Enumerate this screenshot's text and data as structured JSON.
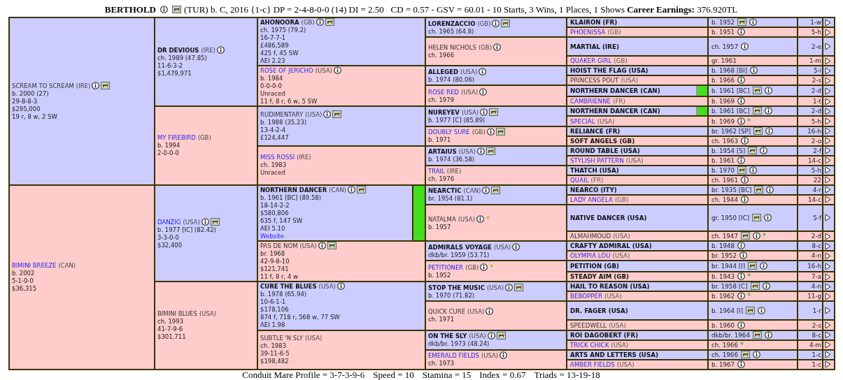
{
  "header": {
    "title": "BERTHOLD",
    "icons": [
      {
        "kind": "info"
      },
      {
        "kind": "photo"
      }
    ],
    "summary": "(TUR) b. C, 2016 {1-c} DP = 2-4-8-0-0 (14) DI = 2.50   CD = 0.57 - GSV = 60.01 - 10 Starts, 3 Wins, 1 Places, 1 Shows **Career Earnings:** 376.920TL"
  },
  "pedigree": [
    {
      "name": "SCREAM TO SCREAM",
      "country": "(IRE)",
      "bold": false,
      "link": false,
      "female": false,
      "icons": [
        {
          "kind": "info"
        },
        {
          "kind": "photo"
        }
      ],
      "lines": [
        "b. 2000 (27)",
        "29-8-8-3",
        "$295,000",
        "19 r, 8 w, 2 SW"
      ],
      "parents": [
        {
          "name": "DR DEVIOUS",
          "country": "(IRE)",
          "bold": true,
          "link": false,
          "female": false,
          "icons": [
            {
              "kind": "info"
            }
          ],
          "lines": [
            "ch. 1989 (47.85)",
            "11-6-3-2",
            "$1,479,971"
          ],
          "parents": [
            {
              "name": "AHONOORA",
              "country": "(GB)",
              "bold": true,
              "link": false,
              "female": false,
              "icons": [
                {
                  "kind": "info"
                },
                {
                  "kind": "photo"
                }
              ],
              "lines": [
                "ch. 1975 (79.2)",
                "16-7-7-1",
                "£486,589",
                "425 f, 45 SW",
                "AEI 2.23"
              ],
              "parents": [
                {
                  "name": "LORENZACCIO",
                  "country": "(GB)",
                  "bold": true,
                  "link": false,
                  "female": false,
                  "icons": [
                    {
                      "kind": "info"
                    },
                    {
                      "kind": "photo"
                    }
                  ],
                  "lines": [
                    "ch. 1965 (64.8)"
                  ],
                  "parents": [
                    {
                      "name": "KLAIRON (FR)",
                      "bold": true,
                      "link": false,
                      "female": false,
                      "info": "b. 1952",
                      "icons": [
                        {
                          "kind": "photo"
                        },
                        {
                          "kind": "info"
                        }
                      ],
                      "code": "1-w"
                    },
                    {
                      "name": "PHOENISSA",
                      "country": "(GB)",
                      "bold": false,
                      "link": true,
                      "female": true,
                      "info": "b. 1951",
                      "icons": [
                        {
                          "kind": "info"
                        }
                      ],
                      "code": "5-h"
                    }
                  ]
                },
                {
                  "name": "HELEN NICHOLS",
                  "country": "(GB)",
                  "bold": false,
                  "link": false,
                  "female": true,
                  "icons": [
                    {
                      "kind": "info"
                    }
                  ],
                  "lines": [
                    "ch. 1966"
                  ],
                  "parents": [
                    {
                      "name": "MARTIAL (IRE)",
                      "bold": true,
                      "link": false,
                      "female": false,
                      "info": "ch. 1957",
                      "icons": [
                        {
                          "kind": "info"
                        }
                      ],
                      "code": "2-e"
                    },
                    {
                      "name": "QUAKER GIRL",
                      "country": "(GB)",
                      "bold": false,
                      "link": true,
                      "female": true,
                      "info": "gr. 1961",
                      "code": "1-m"
                    }
                  ]
                }
              ]
            },
            {
              "name": "ROSE OF JERICHO",
              "country": "(USA)",
              "bold": false,
              "link": true,
              "female": true,
              "icons": [
                {
                  "kind": "info"
                }
              ],
              "lines": [
                "b. 1984",
                "0-0-0-0",
                "Unraced",
                "11 f, 8 r, 6 w, 5 SW"
              ],
              "parents": [
                {
                  "name": "ALLEGED",
                  "country": "(USA)",
                  "bold": true,
                  "link": false,
                  "female": false,
                  "icons": [
                    {
                      "kind": "info"
                    }
                  ],
                  "lines": [
                    "b. 1974 (80.06)"
                  ],
                  "parents": [
                    {
                      "name": "HOIST THE FLAG (USA)",
                      "bold": true,
                      "link": false,
                      "female": false,
                      "info": "b. 1968 [BI]",
                      "icons": [
                        {
                          "kind": "info"
                        }
                      ],
                      "code": "5-i"
                    },
                    {
                      "name": "PRINCESS POUT",
                      "country": "(USA)",
                      "bold": false,
                      "link": false,
                      "female": true,
                      "info": "b. 1966",
                      "icons": [
                        {
                          "kind": "info"
                        }
                      ],
                      "code": "2-s"
                    }
                  ]
                },
                {
                  "name": "ROSE RED",
                  "country": "(USA)",
                  "bold": false,
                  "link": true,
                  "female": true,
                  "icons": [
                    {
                      "kind": "info"
                    }
                  ],
                  "lines": [
                    "ch. 1979"
                  ],
                  "parents": [
                    {
                      "name": "NORTHERN DANCER (CAN)",
                      "bold": true,
                      "link": false,
                      "female": false,
                      "highlighted": true,
                      "info": "b. 1961 [BC]",
                      "icons": [
                        {
                          "kind": "photo"
                        },
                        {
                          "kind": "info"
                        }
                      ],
                      "code": "2-d"
                    },
                    {
                      "name": "CAMBRIENNE",
                      "country": "(FR)",
                      "bold": false,
                      "link": true,
                      "female": true,
                      "info": "b. 1969",
                      "icons": [
                        {
                          "kind": "info"
                        }
                      ],
                      "code": "1-t"
                    }
                  ]
                }
              ]
            }
          ]
        },
        {
          "name": "MY FIREBIRD",
          "country": "(GB)",
          "bold": false,
          "link": true,
          "female": true,
          "lines": [
            "b. 1994",
            "2-0-0-0"
          ],
          "parents": [
            {
              "name": "RUDIMENTARY",
              "country": "(USA)",
              "bold": false,
              "link": false,
              "female": false,
              "icons": [
                {
                  "kind": "info"
                },
                {
                  "kind": "photo"
                }
              ],
              "lines": [
                "b. 1988 (35.23)",
                "13-4-2-4",
                "£124,447"
              ],
              "parents": [
                {
                  "name": "NUREYEV",
                  "country": "(USA)",
                  "bold": true,
                  "link": false,
                  "female": false,
                  "icons": [
                    {
                      "kind": "info"
                    },
                    {
                      "kind": "photo"
                    }
                  ],
                  "lines": [
                    "b. 1977 [C] (85.89)"
                  ],
                  "parents": [
                    {
                      "name": "NORTHERN DANCER (CAN)",
                      "bold": true,
                      "link": false,
                      "female": false,
                      "highlighted": true,
                      "info": "b. 1961 [BC]",
                      "icons": [
                        {
                          "kind": "photo"
                        },
                        {
                          "kind": "info"
                        }
                      ],
                      "code": "2-d"
                    },
                    {
                      "name": "SPECIAL",
                      "country": "(USA)",
                      "bold": false,
                      "link": true,
                      "female": true,
                      "info": "b. 1969",
                      "icons": [
                        {
                          "kind": "info"
                        }
                      ],
                      "note": "*",
                      "code": "5-h"
                    }
                  ]
                },
                {
                  "name": "DOUBLY SURE",
                  "country": "(GB)",
                  "bold": false,
                  "link": true,
                  "female": true,
                  "icons": [
                    {
                      "kind": "info"
                    },
                    {
                      "kind": "photo"
                    }
                  ],
                  "lines": [
                    "b. 1971"
                  ],
                  "parents": [
                    {
                      "name": "RELIANCE (FR)",
                      "bold": true,
                      "link": false,
                      "female": false,
                      "info": "br. 1962 [SP]",
                      "icons": [
                        {
                          "kind": "photo"
                        },
                        {
                          "kind": "info"
                        }
                      ],
                      "code": "16-h"
                    },
                    {
                      "name": "SOFT ANGELS (GB)",
                      "bold": true,
                      "link": false,
                      "female": true,
                      "info": "ch. 1963",
                      "icons": [
                        {
                          "kind": "info"
                        }
                      ],
                      "code": "2-o"
                    }
                  ]
                }
              ]
            },
            {
              "name": "MISS ROSSI",
              "country": "(IRE)",
              "bold": false,
              "link": true,
              "female": true,
              "lines": [
                "ch. 1983",
                "Unraced"
              ],
              "parents": [
                {
                  "name": "ARTAIUS",
                  "country": "(USA)",
                  "bold": true,
                  "link": false,
                  "female": false,
                  "icons": [
                    {
                      "kind": "info"
                    },
                    {
                      "kind": "photo"
                    }
                  ],
                  "lines": [
                    "b. 1974 (36.58)"
                  ],
                  "parents": [
                    {
                      "name": "ROUND TABLE (USA)",
                      "bold": true,
                      "link": false,
                      "female": false,
                      "info": "b. 1954 [S]",
                      "icons": [
                        {
                          "kind": "photo"
                        },
                        {
                          "kind": "info"
                        }
                      ],
                      "code": "2-f"
                    },
                    {
                      "name": "STYLISH PATTERN",
                      "country": "(USA)",
                      "bold": false,
                      "link": true,
                      "female": true,
                      "info": "b. 1961",
                      "icons": [
                        {
                          "kind": "info"
                        }
                      ],
                      "code": "14-c"
                    }
                  ]
                },
                {
                  "name": "TRAIL",
                  "country": "(IRE)",
                  "bold": false,
                  "link": true,
                  "female": true,
                  "lines": [
                    "ch. 1976"
                  ],
                  "parents": [
                    {
                      "name": "THATCH (USA)",
                      "bold": true,
                      "link": false,
                      "female": false,
                      "info": "b. 1970",
                      "icons": [
                        {
                          "kind": "photo"
                        },
                        {
                          "kind": "info"
                        }
                      ],
                      "code": "5-h"
                    },
                    {
                      "name": "QUAIL",
                      "country": "(FR)",
                      "bold": false,
                      "link": true,
                      "female": true,
                      "info": "ch. 1961",
                      "icons": [
                        {
                          "kind": "info"
                        }
                      ],
                      "code": "22"
                    }
                  ]
                }
              ]
            }
          ]
        }
      ]
    },
    {
      "name": "BIMINI BREEZE",
      "country": "(CAN)",
      "bold": false,
      "link": true,
      "female": true,
      "lines": [
        "b. 2002",
        "5-1-0-0",
        "$36,315"
      ],
      "parents": [
        {
          "name": "DANZIG",
          "country": "(USA)",
          "bold": false,
          "link": true,
          "female": false,
          "icons": [
            {
              "kind": "info"
            },
            {
              "kind": "photo"
            }
          ],
          "lines": [
            "b. 1977 [IC] (82.42)",
            "3-3-0-0",
            "$32,400"
          ],
          "parents": [
            {
              "name": "NORTHERN DANCER",
              "country": "(CAN)",
              "bold": true,
              "link": false,
              "female": false,
              "highlighted": true,
              "icons": [
                {
                  "kind": "info"
                },
                {
                  "kind": "photo"
                }
              ],
              "lines": [
                "b. 1961 [BC] (89.58)",
                "18-14-2-2",
                "$580,806",
                "635 f, 147 SW",
                "AEI 5.10"
              ],
              "website": "Website",
              "parents": [
                {
                  "name": "NEARCTIC",
                  "country": "(CAN)",
                  "bold": true,
                  "link": false,
                  "female": false,
                  "icons": [
                    {
                      "kind": "info"
                    },
                    {
                      "kind": "photo"
                    }
                  ],
                  "lines": [
                    "br. 1954 (81.1)"
                  ],
                  "parents": [
                    {
                      "name": "NEARCO (ITY)",
                      "bold": true,
                      "link": false,
                      "female": false,
                      "info": "br. 1935 [BC]",
                      "icons": [
                        {
                          "kind": "photo"
                        },
                        {
                          "kind": "info"
                        }
                      ],
                      "code": "4-r"
                    },
                    {
                      "name": "LADY ANGELA",
                      "country": "(GB)",
                      "bold": false,
                      "link": true,
                      "female": true,
                      "info": "ch. 1944",
                      "icons": [
                        {
                          "kind": "info"
                        }
                      ],
                      "code": "14-c"
                    }
                  ]
                },
                {
                  "name": "NATALMA",
                  "country": "(USA)",
                  "bold": false,
                  "link": false,
                  "female": true,
                  "icons": [
                    {
                      "kind": "info"
                    }
                  ],
                  "note": "*",
                  "lines": [
                    "b. 1957"
                  ],
                  "parents": [
                    {
                      "name": "NATIVE DANCER (USA)",
                      "bold": true,
                      "link": false,
                      "female": false,
                      "info": "gr. 1950 [IC]",
                      "icons": [
                        {
                          "kind": "photo"
                        },
                        {
                          "kind": "info"
                        }
                      ],
                      "code": "5-f"
                    },
                    {
                      "name": "ALMAHMOUD",
                      "country": "(USA)",
                      "bold": false,
                      "link": false,
                      "female": true,
                      "info": "ch. 1947",
                      "icons": [
                        {
                          "kind": "photo"
                        },
                        {
                          "kind": "info"
                        }
                      ],
                      "note": "*",
                      "code": "2-d"
                    }
                  ]
                }
              ]
            },
            {
              "name": "PAS DE NOM",
              "country": "(USA)",
              "bold": false,
              "link": false,
              "female": true,
              "icons": [
                {
                  "kind": "info"
                },
                {
                  "kind": "photo"
                }
              ],
              "lines": [
                "br. 1968",
                "42-9-8-10",
                "$121,741",
                "11 f, 8 r, 4 w"
              ],
              "parents": [
                {
                  "name": "ADMIRALS VOYAGE",
                  "country": "(USA)",
                  "bold": true,
                  "link": false,
                  "female": false,
                  "icons": [
                    {
                      "kind": "info"
                    }
                  ],
                  "lines": [
                    "dkb/br. 1959 (53.71)"
                  ],
                  "parents": [
                    {
                      "name": "CRAFTY ADMIRAL (USA)",
                      "bold": true,
                      "link": false,
                      "female": false,
                      "info": "b. 1948",
                      "icons": [
                        {
                          "kind": "info"
                        }
                      ],
                      "code": "8-c"
                    },
                    {
                      "name": "OLYMPIA LOU",
                      "country": "(USA)",
                      "bold": false,
                      "link": true,
                      "female": true,
                      "info": "br. 1952",
                      "icons": [
                        {
                          "kind": "info"
                        }
                      ],
                      "code": "4-n"
                    }
                  ]
                },
                {
                  "name": "PETITIONER",
                  "country": "(GB)",
                  "bold": false,
                  "link": true,
                  "female": true,
                  "icons": [
                    {
                      "kind": "info"
                    }
                  ],
                  "note": "*",
                  "lines": [
                    "b. 1952"
                  ],
                  "parents": [
                    {
                      "name": "PETITION (GB)",
                      "bold": true,
                      "link": false,
                      "female": false,
                      "info": "br. 1944 [I]",
                      "icons": [
                        {
                          "kind": "photo"
                        },
                        {
                          "kind": "info"
                        }
                      ],
                      "code": "16-h"
                    },
                    {
                      "name": "STEADY AIM (GB)",
                      "bold": true,
                      "link": false,
                      "female": true,
                      "info": "b. 1943",
                      "icons": [
                        {
                          "kind": "info"
                        }
                      ],
                      "note": "*",
                      "code": "7-a"
                    }
                  ]
                }
              ]
            }
          ]
        },
        {
          "name": "BIMINI BLUES",
          "country": "(USA)",
          "bold": false,
          "link": false,
          "female": true,
          "lines": [
            "ch. 1993",
            "41-7-9-6",
            "$301,711"
          ],
          "parents": [
            {
              "name": "CURE THE BLUES",
              "country": "(USA)",
              "bold": true,
              "link": false,
              "female": false,
              "icons": [
                {
                  "kind": "info"
                }
              ],
              "lines": [
                "b. 1978 (65.94)",
                "10-6-1-1",
                "$178,106",
                "874 f, 718 r, 568 w, 77 SW",
                "AEI 1.98"
              ],
              "parents": [
                {
                  "name": "STOP THE MUSIC",
                  "country": "(USA)",
                  "bold": true,
                  "link": false,
                  "female": false,
                  "icons": [
                    {
                      "kind": "info"
                    },
                    {
                      "kind": "photo"
                    }
                  ],
                  "lines": [
                    "b. 1970 (71.82)"
                  ],
                  "parents": [
                    {
                      "name": "HAIL TO REASON (USA)",
                      "bold": true,
                      "link": false,
                      "female": false,
                      "info": "br. 1958 [C]",
                      "icons": [
                        {
                          "kind": "photo"
                        },
                        {
                          "kind": "info"
                        }
                      ],
                      "code": "4-n"
                    },
                    {
                      "name": "BEBOPPER",
                      "country": "(USA)",
                      "bold": false,
                      "link": true,
                      "female": true,
                      "info": "b. 1962",
                      "icons": [
                        {
                          "kind": "info"
                        }
                      ],
                      "note": "*",
                      "code": "11-g"
                    }
                  ]
                },
                {
                  "name": "QUICK CURE",
                  "country": "(USA)",
                  "bold": false,
                  "link": false,
                  "female": true,
                  "icons": [
                    {
                      "kind": "info"
                    }
                  ],
                  "lines": [
                    "ch. 1971"
                  ],
                  "parents": [
                    {
                      "name": "DR. FAGER (USA)",
                      "bold": true,
                      "link": false,
                      "female": false,
                      "info": "b. 1964 [I]",
                      "icons": [
                        {
                          "kind": "photo"
                        },
                        {
                          "kind": "info"
                        }
                      ],
                      "code": "1-r"
                    },
                    {
                      "name": "SPEEDWELL",
                      "country": "(USA)",
                      "bold": false,
                      "link": false,
                      "female": true,
                      "info": "b. 1960",
                      "icons": [
                        {
                          "kind": "info"
                        }
                      ],
                      "code": "2-s"
                    }
                  ]
                }
              ]
            },
            {
              "name": "SUBTLE 'N SLY",
              "country": "(USA)",
              "bold": false,
              "link": false,
              "female": true,
              "lines": [
                "ch. 1983",
                "39-11-6-5",
                "$198,482"
              ],
              "parents": [
                {
                  "name": "ON THE SLY",
                  "country": "(USA)",
                  "bold": true,
                  "link": false,
                  "female": false,
                  "icons": [
                    {
                      "kind": "info"
                    },
                    {
                      "kind": "photo"
                    }
                  ],
                  "lines": [
                    "dkb/br. 1973 (48.24)"
                  ],
                  "parents": [
                    {
                      "name": "ROI DAGOBERT (FR)",
                      "bold": true,
                      "link": false,
                      "female": false,
                      "info": "dkb/br. 1964",
                      "icons": [
                        {
                          "kind": "photo"
                        },
                        {
                          "kind": "info"
                        }
                      ],
                      "code": "8-c"
                    },
                    {
                      "name": "TRICK CHICK",
                      "country": "(USA)",
                      "bold": false,
                      "link": true,
                      "female": true,
                      "info": "ch. 1966",
                      "note": "*",
                      "code": "4-m"
                    }
                  ]
                },
                {
                  "name": "EMERALD FIELDS",
                  "country": "(USA)",
                  "bold": false,
                  "link": true,
                  "female": true,
                  "icons": [
                    {
                      "kind": "info"
                    }
                  ],
                  "lines": [
                    "ch. 1973"
                  ],
                  "parents": [
                    {
                      "name": "ARTS AND LETTERS (USA)",
                      "bold": true,
                      "link": false,
                      "female": false,
                      "info": "ch. 1966",
                      "icons": [
                        {
                          "kind": "photo"
                        },
                        {
                          "kind": "info"
                        }
                      ],
                      "code": "1-c"
                    },
                    {
                      "name": "AMBER FIELDS",
                      "country": "(USA)",
                      "bold": false,
                      "link": true,
                      "female": true,
                      "info": "b. 1967",
                      "icons": [
                        {
                          "kind": "info"
                        }
                      ],
                      "code": "1-c"
                    }
                  ]
                }
              ]
            }
          ]
        }
      ]
    }
  ],
  "footer": [
    "Conduit Mare Profile = 3-7-3-9-6",
    "Speed = 10",
    "Stamina = 15",
    "Index = 0.67",
    "Triads = 13-19-18"
  ]
}
